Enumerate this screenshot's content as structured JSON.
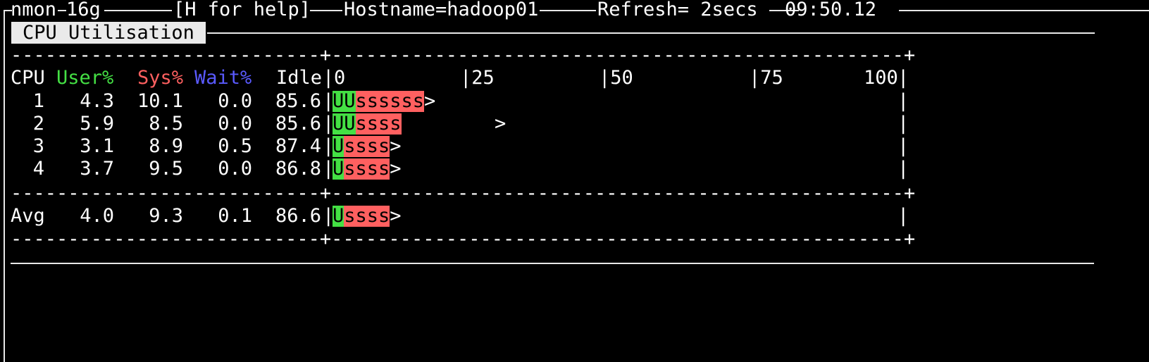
{
  "colors": {
    "user": "#44e044",
    "sys": "#ff6060",
    "wait": "#5a5aff",
    "text": "#ffffff",
    "bg": "#000000"
  },
  "header": {
    "app": "nmon",
    "version": "16g",
    "help": "[H for help]",
    "hostname": "Hostname=hadoop01",
    "refresh": "Refresh= 2secs",
    "time": "09:50.12"
  },
  "panel": {
    "title": "CPU Utilisation"
  },
  "table": {
    "headers": {
      "cpu": "CPU",
      "user": "User%",
      "sys": "Sys%",
      "wait": "Wait%",
      "idle": "Idle"
    },
    "scale": {
      "s0": "0",
      "s25": "|25",
      "s50": "|50",
      "s75": "|75",
      "s100": "100"
    },
    "rows": [
      {
        "cpu": "1",
        "user": "4.3",
        "sys": "10.1",
        "wait": "0.0",
        "idle": "85.6",
        "bar_user": "UU",
        "bar_sys": "ssssss",
        "bar_end": ">"
      },
      {
        "cpu": "2",
        "user": "5.9",
        "sys": "8.5",
        "wait": "0.0",
        "idle": "85.6",
        "bar_user": "UU",
        "bar_sys": "ssss",
        "bar_end": ">"
      },
      {
        "cpu": "3",
        "user": "3.1",
        "sys": "8.9",
        "wait": "0.5",
        "idle": "87.4",
        "bar_user": "U",
        "bar_sys": "ssss",
        "bar_end": ">"
      },
      {
        "cpu": "4",
        "user": "3.7",
        "sys": "9.5",
        "wait": "0.0",
        "idle": "86.8",
        "bar_user": "U",
        "bar_sys": "ssss",
        "bar_end": ">"
      }
    ],
    "avg": {
      "cpu": "Avg",
      "user": "4.0",
      "sys": "9.3",
      "wait": "0.1",
      "idle": "86.6",
      "bar_user": "U",
      "bar_sys": "ssss",
      "bar_end": ">"
    }
  }
}
